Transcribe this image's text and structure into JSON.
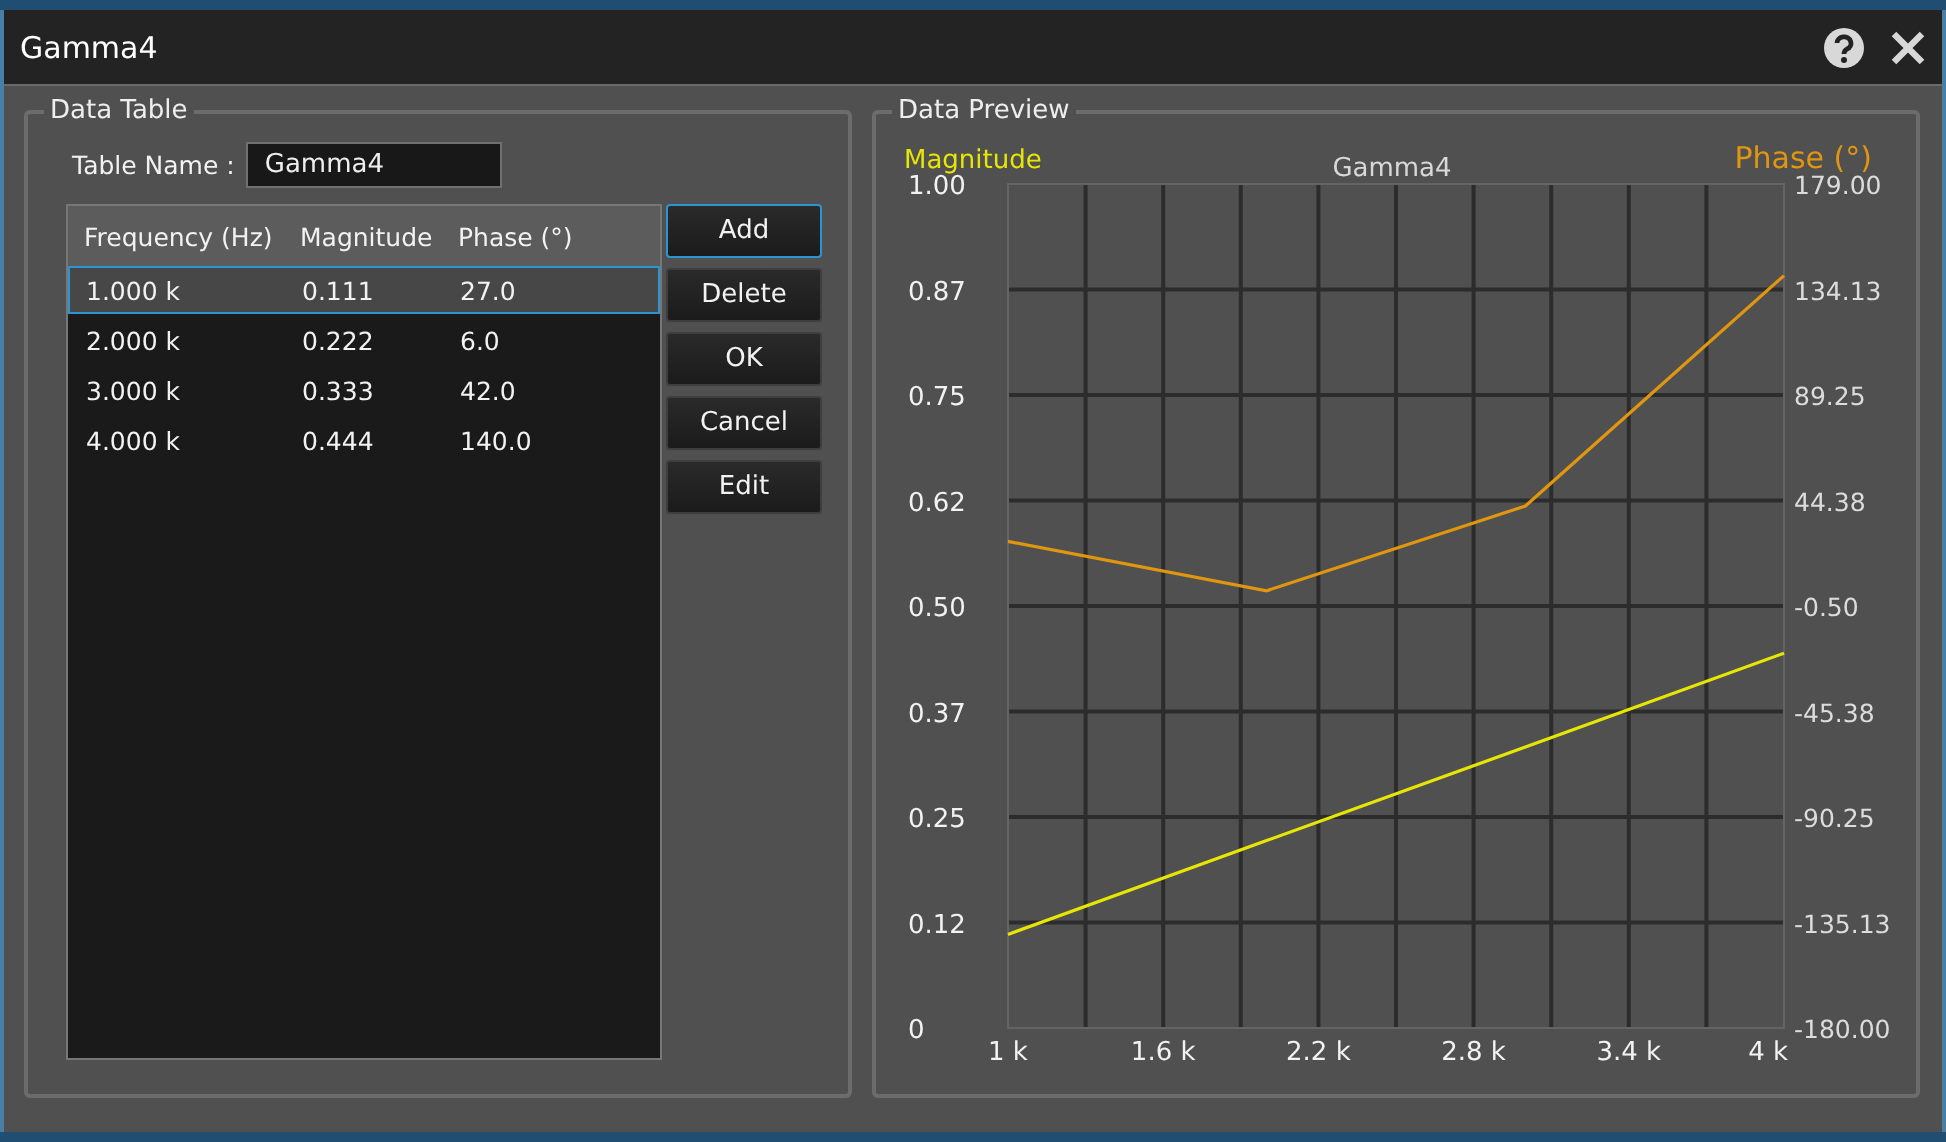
{
  "window": {
    "title": "Gamma4"
  },
  "data_table": {
    "title": "Data Table",
    "table_name_label": "Table Name :",
    "table_name": "Gamma4",
    "columns": [
      "Frequency (Hz)",
      "Magnitude",
      "Phase (°)"
    ],
    "rows": [
      {
        "cells": [
          "1.000 k",
          "0.111",
          "27.0"
        ],
        "selected": true
      },
      {
        "cells": [
          "2.000 k",
          "0.222",
          "6.0"
        ],
        "selected": false
      },
      {
        "cells": [
          "3.000 k",
          "0.333",
          "42.0"
        ],
        "selected": false
      },
      {
        "cells": [
          "4.000 k",
          "0.444",
          "140.0"
        ],
        "selected": false
      }
    ],
    "buttons": [
      {
        "label": "Add",
        "focused": true
      },
      {
        "label": "Delete",
        "focused": false
      },
      {
        "label": "OK",
        "focused": false
      },
      {
        "label": "Cancel",
        "focused": false
      },
      {
        "label": "Edit",
        "focused": false
      }
    ]
  },
  "data_preview": {
    "title": "Data Preview",
    "chart_data": {
      "type": "line",
      "title": "Gamma4",
      "grid": true,
      "x": [
        1000,
        2000,
        3000,
        4000
      ],
      "xlim": [
        1000,
        4000
      ],
      "xticks": [
        {
          "value": 1000,
          "label": "1 k"
        },
        {
          "value": 1600,
          "label": "1.6 k"
        },
        {
          "value": 2200,
          "label": "2.2 k"
        },
        {
          "value": 2800,
          "label": "2.8 k"
        },
        {
          "value": 3400,
          "label": "3.4 k"
        },
        {
          "value": 4000,
          "label": "4 k"
        }
      ],
      "ylim": [
        0,
        1
      ],
      "yticks": [
        {
          "value": 0,
          "label": "0"
        },
        {
          "value": 0.125,
          "label": "0.12"
        },
        {
          "value": 0.25,
          "label": "0.25"
        },
        {
          "value": 0.375,
          "label": "0.37"
        },
        {
          "value": 0.5,
          "label": "0.50"
        },
        {
          "value": 0.625,
          "label": "0.62"
        },
        {
          "value": 0.75,
          "label": "0.75"
        },
        {
          "value": 0.875,
          "label": "0.87"
        },
        {
          "value": 1,
          "label": "1.00"
        }
      ],
      "y2lim": [
        -180,
        179
      ],
      "y2ticks": [
        {
          "value": -180,
          "label": "-180.00"
        },
        {
          "value": -135.125,
          "label": "-135.13"
        },
        {
          "value": -90.25,
          "label": "-90.25"
        },
        {
          "value": -45.375,
          "label": "-45.38"
        },
        {
          "value": -0.5,
          "label": "-0.50"
        },
        {
          "value": 44.375,
          "label": "44.38"
        },
        {
          "value": 89.25,
          "label": "89.25"
        },
        {
          "value": 134.125,
          "label": "134.13"
        },
        {
          "value": 179,
          "label": "179.00"
        }
      ],
      "series": [
        {
          "name": "Magnitude",
          "color": "#e6e600",
          "axis": "y",
          "values": [
            0.111,
            0.222,
            0.333,
            0.444
          ]
        },
        {
          "name": "Phase (°)",
          "color": "#e0960f",
          "axis": "y2",
          "values": [
            27,
            6,
            42,
            140
          ]
        }
      ]
    }
  }
}
